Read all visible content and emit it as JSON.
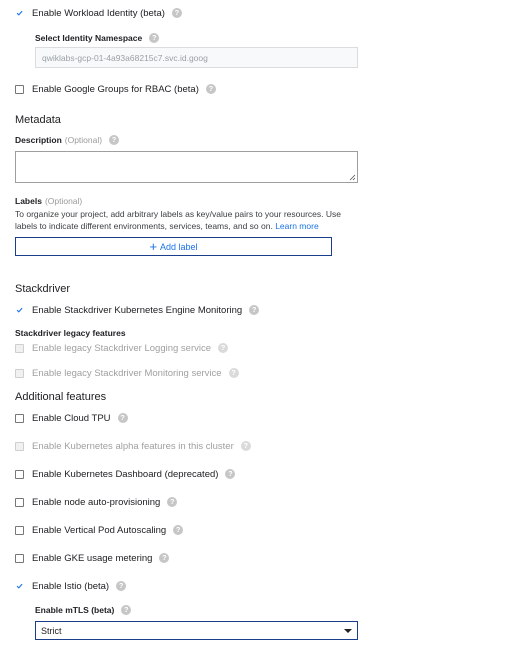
{
  "workload_identity": {
    "label": "Enable Workload Identity (beta)",
    "checked": true
  },
  "identity_namespace": {
    "label": "Select Identity Namespace",
    "value": "qwiklabs-gcp-01-4a93a68215c7.svc.id.goog"
  },
  "google_groups": {
    "label": "Enable Google Groups for RBAC (beta)",
    "checked": false
  },
  "metadata": {
    "title": "Metadata",
    "description_label": "Description",
    "optional": "(Optional)",
    "labels_label": "Labels",
    "labels_help": "To organize your project, add arbitrary labels as key/value pairs to your resources. Use labels to indicate different environments, services, teams, and so on.",
    "learn_more": "Learn more",
    "add_label": "Add label"
  },
  "stackdriver": {
    "title": "Stackdriver",
    "monitoring": {
      "label": "Enable Stackdriver Kubernetes Engine Monitoring",
      "checked": true
    },
    "legacy_title": "Stackdriver legacy features",
    "legacy_logging": "Enable legacy Stackdriver Logging service",
    "legacy_monitoring": "Enable legacy Stackdriver Monitoring service"
  },
  "additional": {
    "title": "Additional features",
    "cloud_tpu": "Enable Cloud TPU",
    "alpha": "Enable Kubernetes alpha features in this cluster",
    "dashboard": "Enable Kubernetes Dashboard (deprecated)",
    "nap": "Enable node auto-provisioning",
    "vpa": "Enable Vertical Pod Autoscaling",
    "gke_metering": "Enable GKE usage metering",
    "istio": {
      "label": "Enable Istio (beta)",
      "checked": true
    },
    "mtls_label": "Enable mTLS (beta)",
    "mtls_value": "Strict"
  },
  "colors": {
    "accent": "#1a73e8",
    "check": "#1a73e8"
  },
  "help_icon": "help-circle-icon"
}
